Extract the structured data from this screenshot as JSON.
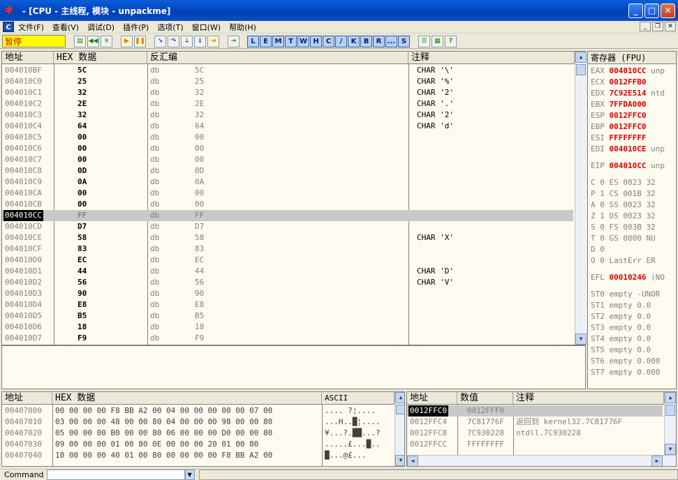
{
  "window": {
    "title": "- [CPU - 主线程, 模块 - unpackme]"
  },
  "menu": [
    "文件(F)",
    "查看(V)",
    "调试(D)",
    "插件(P)",
    "选项(T)",
    "窗口(W)",
    "帮助(H)"
  ],
  "toolbar": {
    "status": "暂停",
    "letters": [
      "L",
      "E",
      "M",
      "T",
      "W",
      "H",
      "C",
      "/",
      "K",
      "B",
      "R",
      "...",
      "S"
    ]
  },
  "disasm": {
    "headers": [
      "地址",
      "HEX 数据",
      "反汇编",
      "注释"
    ],
    "rows": [
      {
        "addr": "004010BF",
        "hex": "5C",
        "op": "db",
        "arg": "5C",
        "comment": "CHAR '\\'"
      },
      {
        "addr": "004010C0",
        "hex": "25",
        "op": "db",
        "arg": "25",
        "comment": "CHAR '%'"
      },
      {
        "addr": "004010C1",
        "hex": "32",
        "op": "db",
        "arg": "32",
        "comment": "CHAR '2'"
      },
      {
        "addr": "004010C2",
        "hex": "2E",
        "op": "db",
        "arg": "2E",
        "comment": "CHAR '.'"
      },
      {
        "addr": "004010C3",
        "hex": "32",
        "op": "db",
        "arg": "32",
        "comment": "CHAR '2'"
      },
      {
        "addr": "004010C4",
        "hex": "64",
        "op": "db",
        "arg": "64",
        "comment": "CHAR 'd'"
      },
      {
        "addr": "004010C5",
        "hex": "00",
        "op": "db",
        "arg": "00",
        "comment": ""
      },
      {
        "addr": "004010C6",
        "hex": "00",
        "op": "db",
        "arg": "00",
        "comment": ""
      },
      {
        "addr": "004010C7",
        "hex": "00",
        "op": "db",
        "arg": "00",
        "comment": ""
      },
      {
        "addr": "004010C8",
        "hex": "0D",
        "op": "db",
        "arg": "0D",
        "comment": ""
      },
      {
        "addr": "004010C9",
        "hex": "0A",
        "op": "db",
        "arg": "0A",
        "comment": ""
      },
      {
        "addr": "004010CA",
        "hex": "00",
        "op": "db",
        "arg": "00",
        "comment": ""
      },
      {
        "addr": "004010CB",
        "hex": "00",
        "op": "db",
        "arg": "00",
        "comment": ""
      },
      {
        "addr": "004010CC",
        "hex": "FF",
        "op": "db",
        "arg": "FF",
        "comment": "",
        "selected": true
      },
      {
        "addr": "004010CD",
        "hex": "D7",
        "op": "db",
        "arg": "D7",
        "comment": ""
      },
      {
        "addr": "004010CE",
        "hex": "58",
        "op": "db",
        "arg": "58",
        "comment": "CHAR 'X'"
      },
      {
        "addr": "004010CF",
        "hex": "83",
        "op": "db",
        "arg": "83",
        "comment": ""
      },
      {
        "addr": "004010D0",
        "hex": "EC",
        "op": "db",
        "arg": "EC",
        "comment": ""
      },
      {
        "addr": "004010D1",
        "hex": "44",
        "op": "db",
        "arg": "44",
        "comment": "CHAR 'D'"
      },
      {
        "addr": "004010D2",
        "hex": "56",
        "op": "db",
        "arg": "56",
        "comment": "CHAR 'V'"
      },
      {
        "addr": "004010D3",
        "hex": "90",
        "op": "db",
        "arg": "90",
        "comment": ""
      },
      {
        "addr": "004010D4",
        "hex": "E8",
        "op": "db",
        "arg": "E8",
        "comment": ""
      },
      {
        "addr": "004010D5",
        "hex": "B5",
        "op": "db",
        "arg": "B5",
        "comment": ""
      },
      {
        "addr": "004010D6",
        "hex": "18",
        "op": "db",
        "arg": "18",
        "comment": ""
      },
      {
        "addr": "004010D7",
        "hex": "F9",
        "op": "db",
        "arg": "F9",
        "comment": ""
      }
    ]
  },
  "registers": {
    "header": "寄存器 (FPU)",
    "gp": [
      {
        "name": "EAX",
        "val": "004010CC",
        "ext": "unp"
      },
      {
        "name": "ECX",
        "val": "0012FFB0",
        "ext": ""
      },
      {
        "name": "EDX",
        "val": "7C92E514",
        "ext": "ntd"
      },
      {
        "name": "EBX",
        "val": "7FFDA000",
        "ext": ""
      },
      {
        "name": "ESP",
        "val": "0012FFC0",
        "ext": ""
      },
      {
        "name": "EBP",
        "val": "0012FFC0",
        "ext": ""
      },
      {
        "name": "ESI",
        "val": "FFFFFFFF",
        "ext": ""
      },
      {
        "name": "EDI",
        "val": "004010CE",
        "ext": "unp"
      }
    ],
    "eip": {
      "name": "EIP",
      "val": "004010CC",
      "ext": "unp"
    },
    "flags": [
      "C 0  ES 0023 32",
      "P 1  CS 001B 32",
      "A 0  SS 0023 32",
      "Z 1  DS 0023 32",
      "S 0  FS 003B 32",
      "T 0  GS 0000 NU",
      "D 0",
      "O 0  LastErr ER"
    ],
    "efl": {
      "name": "EFL",
      "val": "00010246",
      "ext": "(NO"
    },
    "fpu": [
      "ST0 empty -UNOR",
      "ST1 empty 0.0",
      "ST2 empty 0.0",
      "ST3 empty 0.0",
      "ST4 empty 0.0",
      "ST5 empty 0.0",
      "ST6 empty 0.000",
      "ST7 empty 0.000"
    ]
  },
  "dump": {
    "headers": [
      "地址",
      "HEX 数据",
      "ASCII"
    ],
    "rows": [
      {
        "addr": "00407000",
        "hex": "00 00 00 00 F8 BB A2 00 04 00 00 00 00 00 07 00",
        "ascii": "....  ?¦...."
      },
      {
        "addr": "00407010",
        "hex": "03 00 00 00 48 00 00 80 04 00 00 00 98 00 00 80",
        "ascii": "...H..█¦...."
      },
      {
        "addr": "00407020",
        "hex": "05 00 00 00 B0 00 00 80 06 00 00 00 D0 00 00 80",
        "ascii": "¥...?.██...?"
      },
      {
        "addr": "00407030",
        "hex": "09 00 00 00 01 00 80 0E 00 00 00 20 01 00 80",
        "ascii": ".....£...█.."
      },
      {
        "addr": "00407040",
        "hex": "10 00 00 00 40 01 00 80 00 00 00 00 F8 BB A2 00",
        "ascii": "█...@£..."
      }
    ]
  },
  "stack": {
    "headers": [
      "地址",
      "数值",
      "注释"
    ],
    "rows": [
      {
        "addr": "0012FFC0",
        "val": "0012FFF0",
        "comment": "",
        "selected": true
      },
      {
        "addr": "0012FFC4",
        "val": "7C81776F",
        "comment": "返回到 kernel32.7C81776F"
      },
      {
        "addr": "0012FFC8",
        "val": "7C930228",
        "comment": "ntdll.7C930228"
      },
      {
        "addr": "0012FFCC",
        "val": "FFFFFFFF",
        "comment": ""
      }
    ]
  },
  "command": {
    "label": "Command"
  }
}
